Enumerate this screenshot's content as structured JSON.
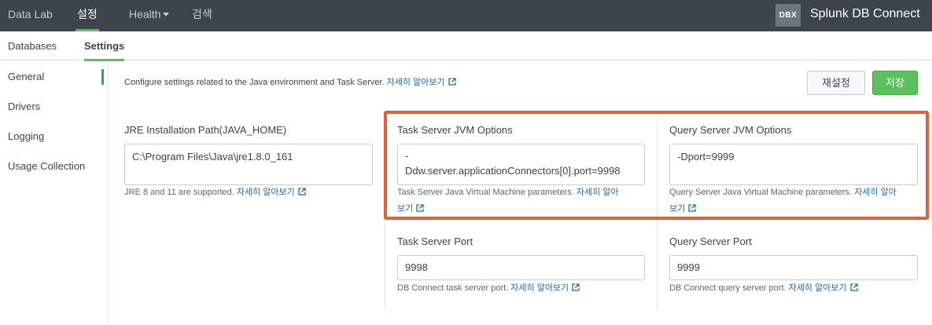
{
  "topnav": {
    "items": [
      {
        "label": "Data Lab"
      },
      {
        "label": "설정"
      },
      {
        "label": "Health"
      },
      {
        "label": "검색"
      }
    ],
    "active_index": 1,
    "app_logo": "DBX",
    "app_title": "Splunk DB Connect"
  },
  "subnav": {
    "items": [
      {
        "label": "Databases"
      },
      {
        "label": "Settings"
      }
    ],
    "active_index": 1
  },
  "sidebar": {
    "items": [
      {
        "label": "General"
      },
      {
        "label": "Drivers"
      },
      {
        "label": "Logging"
      },
      {
        "label": "Usage Collection"
      }
    ],
    "active_index": 0
  },
  "main": {
    "intro_text": "Configure settings related to the Java environment and Task Server. ",
    "learn_more": "자세히 알아보기",
    "learn_more_wrapped_1": "자세히 알아",
    "learn_more_wrapped_2": "보기",
    "reset_label": "재설정",
    "save_label": "저장",
    "jre": {
      "label": "JRE Installation Path(JAVA_HOME)",
      "value": "C:\\Program Files\\Java\\jre1.8.0_161",
      "help": "JRE 8 and 11 are supported. "
    },
    "task_jvm": {
      "label": "Task Server JVM Options",
      "value_line1": "-",
      "value_line2": "Ddw.server.applicationConnectors[0].port=9998",
      "help": "Task Server Java Virtual Machine parameters. "
    },
    "query_jvm": {
      "label": "Query Server JVM Options",
      "value": "-Dport=9999",
      "help": "Query Server Java Virtual Machine parameters. "
    },
    "task_port": {
      "label": "Task Server Port",
      "value": "9998",
      "help": "DB Connect task server port. "
    },
    "query_port": {
      "label": "Query Server Port",
      "value": "9999",
      "help": "DB Connect query server port. "
    }
  },
  "colors": {
    "topbar": "#3c444d",
    "accent_green": "#5cc05c",
    "link_blue": "#1a6cb4",
    "highlight_orange": "#e0603c"
  },
  "icons": {
    "external_link": "external-link-icon",
    "caret": "caret-down-icon"
  }
}
